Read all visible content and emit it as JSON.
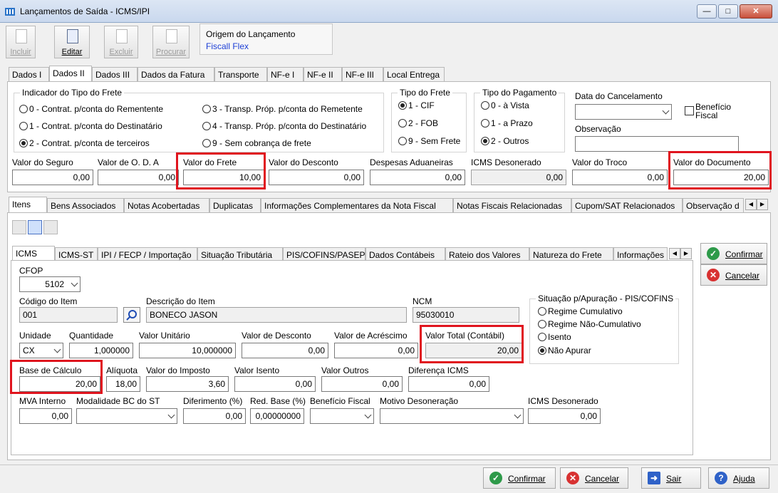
{
  "window": {
    "title": "Lançamentos de Saída - ICMS/IPI"
  },
  "toolbar": {
    "incluir": "Incluir",
    "editar": "Editar",
    "excluir": "Excluir",
    "procurar": "Procurar",
    "origem_label": "Origem do Lançamento",
    "origem_value": "Fiscall Flex"
  },
  "top_tabs": [
    "Dados I",
    "Dados II",
    "Dados III",
    "Dados da Fatura",
    "Transporte",
    "NF-e I",
    "NF-e II",
    "NF-e III",
    "Local Entrega"
  ],
  "frete": {
    "group_label": "Indicador do Tipo do Frete",
    "opt0": "0 - Contrat. p/conta do Rementente",
    "opt1": "1 - Contrat. p/conta do Destinatário",
    "opt2": "2 - Contrat. p/conta de terceiros",
    "opt3": "3 - Transp. Próp. p/conta do Remetente",
    "opt4": "4 - Transp. Próp. p/conta do Destinatário",
    "opt9": "9 - Sem cobrança de frete",
    "tipo_label": "Tipo do Frete",
    "tipo1": "1 - CIF",
    "tipo2": "2 - FOB",
    "tipo9": "9 - Sem Frete",
    "pag_label": "Tipo do Pagamento",
    "pag0": "0 - à Vista",
    "pag1": "1 - a Prazo",
    "pag2": "2 - Outros",
    "cancel_label": "Data do Cancelamento",
    "beneficio_label": "Benefício Fiscal",
    "obs_label": "Observação"
  },
  "values": {
    "seguro_label": "Valor do Seguro",
    "seguro": "0,00",
    "oda_label": "Valor de O. D. A",
    "oda": "0,00",
    "frete_label": "Valor do Frete",
    "frete": "10,00",
    "desconto_label": "Valor do Desconto",
    "desconto": "0,00",
    "aduaneiras_label": "Despesas Aduaneiras",
    "aduaneiras": "0,00",
    "desonerado_label": "ICMS Desonerado",
    "desonerado": "0,00",
    "troco_label": "Valor do Troco",
    "troco": "0,00",
    "documento_label": "Valor do Documento",
    "documento": "20,00"
  },
  "mid_tabs": [
    "Itens",
    "Bens Associados",
    "Notas Acobertadas",
    "Duplicatas",
    "Informações Complementares da Nota Fiscal",
    "Notas Fiscais Relacionadas",
    "Cupom/SAT Relacionados",
    "Observação d"
  ],
  "item_tabs": [
    "ICMS",
    "ICMS-ST",
    "IPI / FECP / Importação",
    "Situação Tributária",
    "PIS/COFINS/PASEP",
    "Dados Contábeis",
    "Rateio dos Valores",
    "Natureza do Frete",
    "Informações"
  ],
  "item": {
    "cfop_label": "CFOP",
    "cfop": "5102",
    "codigo_label": "Código do Item",
    "codigo": "001",
    "descricao_label": "Descrição do Item",
    "descricao": "BONECO JASON",
    "ncm_label": "NCM",
    "ncm": "95030010",
    "situacao_label": "Situação p/Apuração - PIS/COFINS",
    "sit1": "Regime Cumulativo",
    "sit2": "Regime Não-Cumulativo",
    "sit3": "Isento",
    "sit4": "Não Apurar",
    "unidade_label": "Unidade",
    "unidade": "CX",
    "quantidade_label": "Quantidade",
    "quantidade": "1,000000",
    "unitario_label": "Valor Unitário",
    "unitario": "10,000000",
    "vdesconto_label": "Valor de Desconto",
    "vdesconto": "0,00",
    "acrescimo_label": "Valor de Acréscimo",
    "acrescimo": "0,00",
    "total_label": "Valor Total (Contábil)",
    "total": "20,00",
    "base_label": "Base de Cálculo",
    "base": "20,00",
    "aliquota_label": "Alíquota",
    "aliquota": "18,00",
    "imposto_label": "Valor do Imposto",
    "imposto": "3,60",
    "isento_label": "Valor Isento",
    "isento": "0,00",
    "outros_label": "Valor Outros",
    "outros": "0,00",
    "diferenca_label": "Diferença ICMS",
    "diferenca": "0,00",
    "mva_label": "MVA Interno",
    "mva": "0,00",
    "modalidade_label": "Modalidade BC do ST",
    "diferimento_label": "Diferimento (%)",
    "diferimento": "0,00",
    "redbase_label": "Red. Base (%)",
    "redbase": "0,00000000",
    "beneficio_label": "Benefício Fiscal",
    "motivo_label": "Motivo Desoneração",
    "icmsdes_label": "ICMS Desonerado",
    "icmsdes": "0,00"
  },
  "side": {
    "confirmar": "Confirmar",
    "cancelar": "Cancelar"
  },
  "footer": {
    "confirmar": "Confirmar",
    "cancelar": "Cancelar",
    "sair": "Sair",
    "ajuda": "Ajuda"
  },
  "colors": {
    "highlight": "#e0141e",
    "link": "#1d3fd6"
  }
}
